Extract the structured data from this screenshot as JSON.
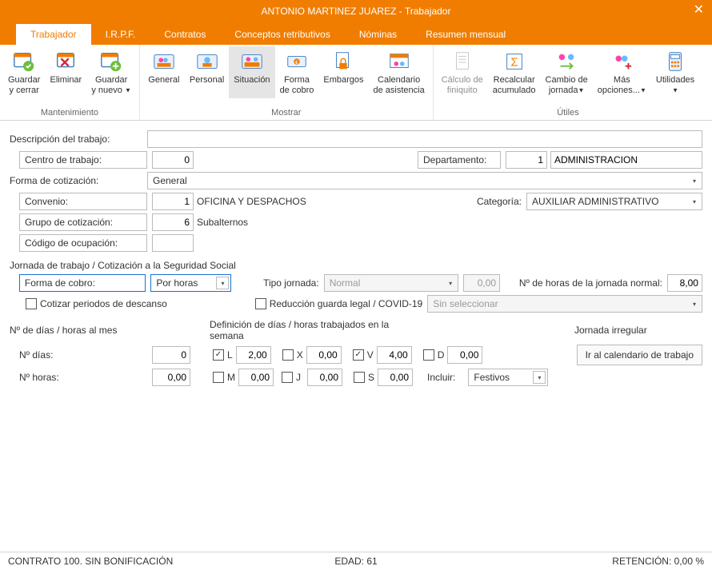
{
  "title": "ANTONIO MARTINEZ JUAREZ - Trabajador",
  "tabs": [
    "Trabajador",
    "I.R.P.F.",
    "Contratos",
    "Conceptos retributivos",
    "Nóminas",
    "Resumen mensual"
  ],
  "ribbon": {
    "groups": [
      {
        "name": "Mantenimiento",
        "items": [
          {
            "l1": "Guardar",
            "l2": "y cerrar"
          },
          {
            "l1": "Eliminar",
            "l2": ""
          },
          {
            "l1": "Guardar",
            "l2": "y nuevo",
            "caret": true
          }
        ]
      },
      {
        "name": "Mostrar",
        "items": [
          {
            "l1": "General",
            "l2": ""
          },
          {
            "l1": "Personal",
            "l2": ""
          },
          {
            "l1": "Situación",
            "l2": "",
            "active": true
          },
          {
            "l1": "Forma",
            "l2": "de cobro"
          },
          {
            "l1": "Embargos",
            "l2": ""
          },
          {
            "l1": "Calendario",
            "l2": "de asistencia"
          }
        ]
      },
      {
        "name": "Útiles",
        "items": [
          {
            "l1": "Cálculo de",
            "l2": "finiquito",
            "disabled": true
          },
          {
            "l1": "Recalcular",
            "l2": "acumulado"
          },
          {
            "l1": "Cambio de",
            "l2": "jornada",
            "caret": true
          },
          {
            "l1": "Más",
            "l2": "opciones...",
            "caret": true
          },
          {
            "l1": "Utilidades",
            "l2": "",
            "caret": true
          }
        ]
      }
    ]
  },
  "form": {
    "descripcion_lbl": "Descripción del trabajo:",
    "descripcion_val": "",
    "centro_lbl": "Centro de trabajo:",
    "centro_val": "0",
    "departamento_lbl": "Departamento:",
    "departamento_val": "1",
    "departamento_name": "ADMINISTRACION",
    "forma_cot_lbl": "Forma de cotización:",
    "forma_cot_val": "General",
    "convenio_lbl": "Convenio:",
    "convenio_val": "1",
    "convenio_name": "OFICINA Y DESPACHOS",
    "categoria_lbl": "Categoría:",
    "categoria_val": "AUXILIAR ADMINISTRATIVO",
    "grupo_cot_lbl": "Grupo de cotización:",
    "grupo_cot_val": "6",
    "grupo_cot_name": "Subalternos",
    "codigo_ocu_lbl": "Código de ocupación:",
    "codigo_ocu_val": ""
  },
  "section1": {
    "title": "Jornada de trabajo /  Cotización a la Seguridad Social",
    "forma_cobro_lbl": "Forma de cobro:",
    "forma_cobro_val": "Por horas",
    "tipo_jornada_lbl": "Tipo jornada:",
    "tipo_jornada_val": "Normal",
    "tipo_jornada_hours": "0,00",
    "horas_normal_lbl": "Nº de horas de la jornada normal:",
    "horas_normal_val": "8,00",
    "cotizar_lbl": "Cotizar periodos de descanso",
    "reduccion_lbl": "Reducción guarda legal / COVID-19",
    "reduccion_sel": "Sin seleccionar"
  },
  "section2": {
    "col1_title": "Nº de días / horas al mes",
    "col2_title": "Definición de días / horas trabajados en la semana",
    "col3_title": "Jornada irregular",
    "ndias_lbl": "Nº días:",
    "ndias_val": "0",
    "nhoras_lbl": "Nº horas:",
    "nhoras_val": "0,00",
    "days": {
      "L": {
        "checked": true,
        "v": "2,00"
      },
      "M": {
        "checked": false,
        "v": "0,00"
      },
      "X": {
        "checked": false,
        "v": "0,00"
      },
      "J": {
        "checked": false,
        "v": "0,00"
      },
      "V": {
        "checked": true,
        "v": "4,00"
      },
      "S": {
        "checked": false,
        "v": "0,00"
      },
      "D": {
        "checked": false,
        "v": "0,00"
      }
    },
    "incluir_lbl": "Incluir:",
    "incluir_val": "Festivos",
    "calendario_btn": "Ir al calendario de trabajo"
  },
  "status": {
    "left": "CONTRATO 100.  SIN BONIFICACIÓN",
    "mid": "EDAD: 61",
    "right": "RETENCIÓN: 0,00 %"
  }
}
